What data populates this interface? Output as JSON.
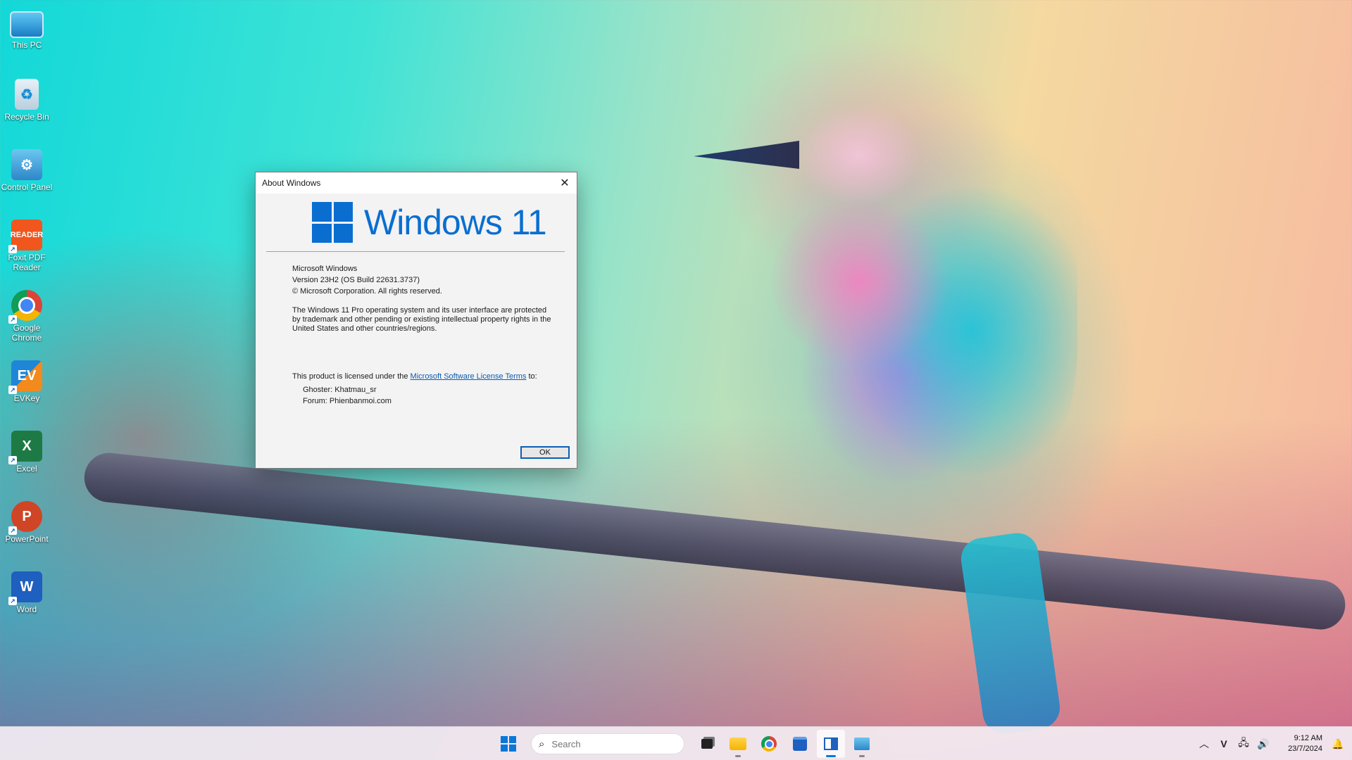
{
  "desktop": {
    "icons": [
      {
        "label": "This PC"
      },
      {
        "label": "Recycle Bin"
      },
      {
        "label": "Control Panel"
      },
      {
        "label": "Foxit PDF Reader"
      },
      {
        "label": "Google Chrome"
      },
      {
        "label": "EVKey"
      },
      {
        "label": "Excel"
      },
      {
        "label": "PowerPoint"
      },
      {
        "label": "Word"
      }
    ]
  },
  "dialog": {
    "title": "About Windows",
    "logo_text": "Windows 11",
    "line1": "Microsoft Windows",
    "line2": "Version 23H2 (OS Build 22631.3737)",
    "line3": "© Microsoft Corporation. All rights reserved.",
    "paragraph": "The Windows 11 Pro operating system and its user interface are protected by trademark and other pending or existing intellectual property rights in the United States and other countries/regions.",
    "license_prefix": "This product is licensed under the ",
    "license_link": "Microsoft Software License Terms",
    "license_suffix": " to:",
    "licensee1": "Ghoster: Khatmau_sr",
    "licensee2": "Forum: Phienbanmoi.com",
    "ok_label": "OK"
  },
  "taskbar": {
    "search_placeholder": "Search",
    "time": "9:12 AM",
    "date": "23/7/2024"
  },
  "colors": {
    "accent": "#0a6ed1",
    "link": "#0b5cad"
  }
}
